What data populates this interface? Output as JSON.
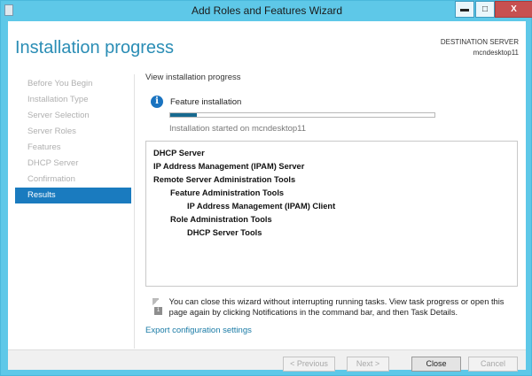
{
  "window": {
    "title": "Add Roles and Features Wizard",
    "minimize": "▬",
    "maximize": "□",
    "close": "X"
  },
  "header": {
    "title": "Installation progress",
    "destination_label": "DESTINATION SERVER",
    "destination_server": "mcndesktop11"
  },
  "sidebar": {
    "items": [
      {
        "label": "Before You Begin",
        "active": false
      },
      {
        "label": "Installation Type",
        "active": false
      },
      {
        "label": "Server Selection",
        "active": false
      },
      {
        "label": "Server Roles",
        "active": false
      },
      {
        "label": "Features",
        "active": false
      },
      {
        "label": "DHCP Server",
        "active": false
      },
      {
        "label": "Confirmation",
        "active": false
      },
      {
        "label": "Results",
        "active": true
      }
    ]
  },
  "main": {
    "view_label": "View installation progress",
    "feature_label": "Feature installation",
    "info_icon": "i",
    "progress_percent": 10,
    "started_text": "Installation started on mcndesktop11",
    "items": [
      {
        "label": "DHCP Server",
        "level": 0
      },
      {
        "label": "IP Address Management (IPAM) Server",
        "level": 0
      },
      {
        "label": "Remote Server Administration Tools",
        "level": 0
      },
      {
        "label": "Feature Administration Tools",
        "level": 1
      },
      {
        "label": "IP Address Management (IPAM) Client",
        "level": 2
      },
      {
        "label": "Role Administration Tools",
        "level": 1
      },
      {
        "label": "DHCP Server Tools",
        "level": 2
      }
    ],
    "note": "You can close this wizard without interrupting running tasks. View task progress or open this page again by clicking Notifications in the command bar, and then Task Details.",
    "note_icon_badge": "1",
    "export_link": "Export configuration settings"
  },
  "footer": {
    "previous": "< Previous",
    "next": "Next >",
    "close": "Close",
    "cancel": "Cancel"
  },
  "colors": {
    "titlebar": "#5ec8e8",
    "accent": "#1a7bbf",
    "progress": "#17698f",
    "close_button": "#c75050"
  }
}
